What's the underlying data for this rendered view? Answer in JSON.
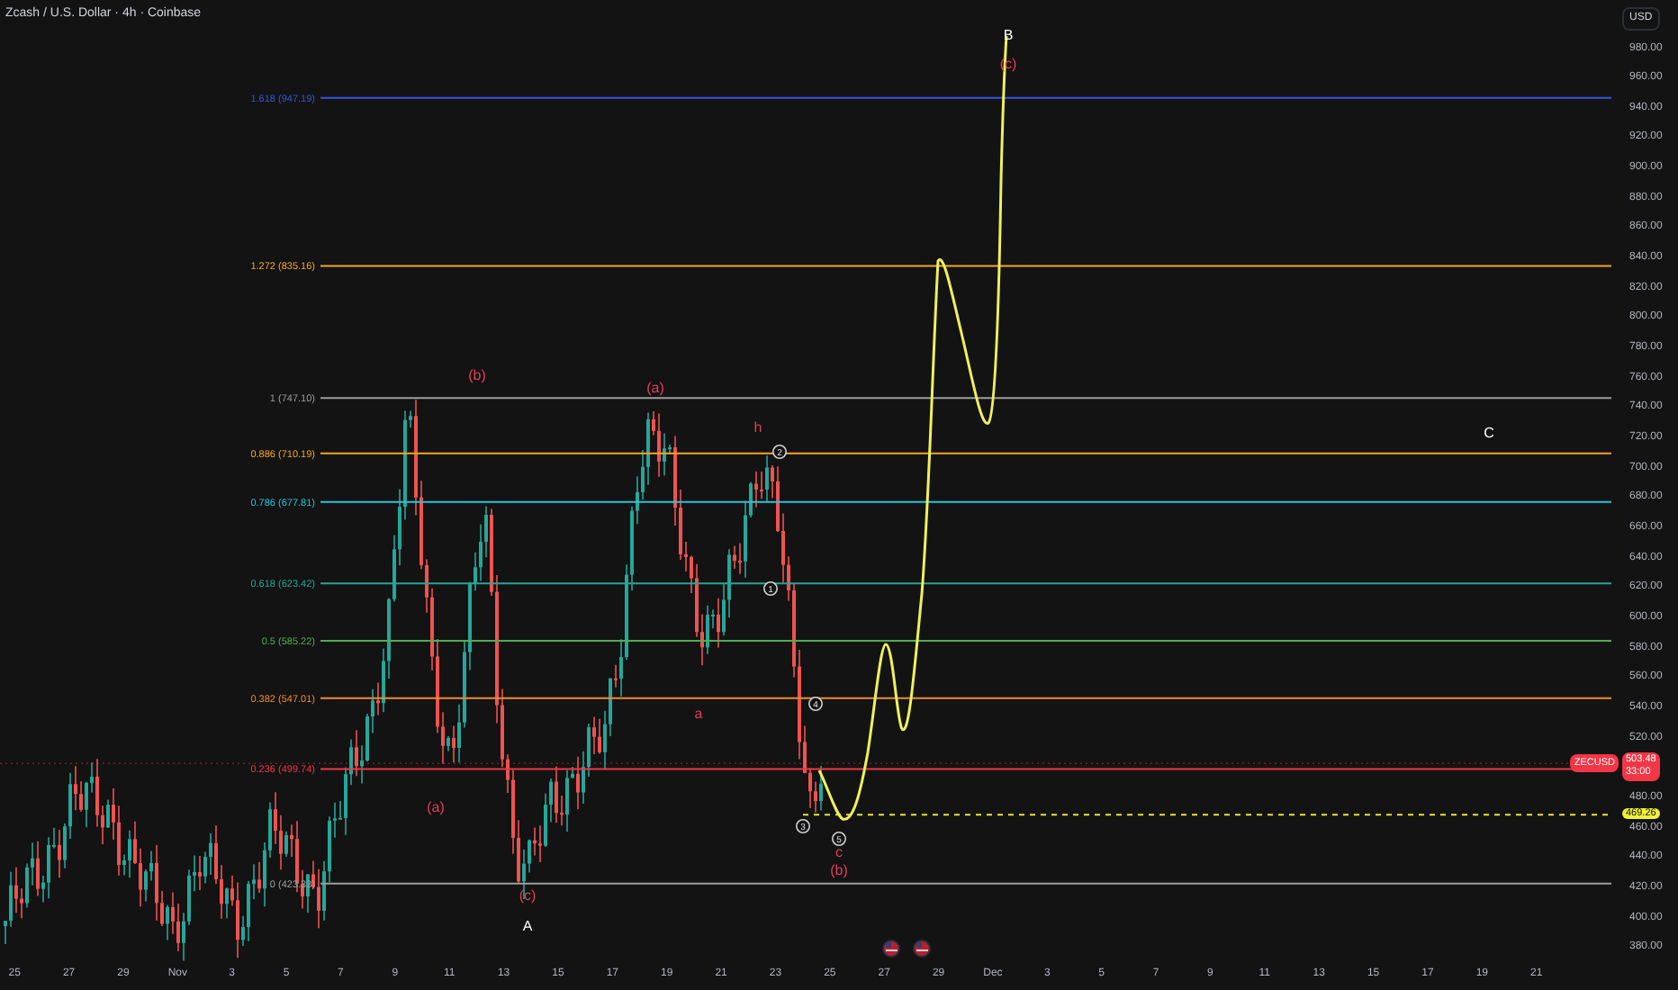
{
  "header": {
    "title": "Zcash / U.S. Dollar · 4h · Coinbase"
  },
  "currency": "USD",
  "price_axis": [
    "980.00",
    "960.00",
    "940.00",
    "920.00",
    "900.00",
    "880.00",
    "860.00",
    "840.00",
    "820.00",
    "800.00",
    "780.00",
    "760.00",
    "740.00",
    "720.00",
    "700.00",
    "680.00",
    "660.00",
    "640.00",
    "620.00",
    "600.00",
    "580.00",
    "560.00",
    "540.00",
    "520.00",
    "480.00",
    "460.00",
    "440.00",
    "420.00",
    "400.00",
    "380.00"
  ],
  "time_axis": [
    "25",
    "27",
    "29",
    "Nov",
    "3",
    "5",
    "7",
    "9",
    "11",
    "13",
    "15",
    "17",
    "19",
    "21",
    "23",
    "25",
    "27",
    "29",
    "Dec",
    "3",
    "5",
    "7",
    "9",
    "11",
    "13",
    "15",
    "17",
    "19",
    "21"
  ],
  "fib_levels": [
    {
      "label": "1.618 (947.19)",
      "color": "#3656e0"
    },
    {
      "label": "1.272 (835.16)",
      "color": "#f5a623"
    },
    {
      "label": "1 (747.10)",
      "color": "#9e9e9e"
    },
    {
      "label": "0.886 (710.19)",
      "color": "#f5a623"
    },
    {
      "label": "0.786 (677.81)",
      "color": "#26c6da"
    },
    {
      "label": "0.618 (623.42)",
      "color": "#26a69a"
    },
    {
      "label": "0.5 (585.22)",
      "color": "#4caf50"
    },
    {
      "label": "0.382 (547.01)",
      "color": "#f08c2e"
    },
    {
      "label": "0.236 (499.74)",
      "color": "#f23645"
    },
    {
      "label": "0 (423.33)",
      "color": "#9e9e9e"
    }
  ],
  "wave_labels": [
    {
      "text": "B",
      "color": "#ffffff"
    },
    {
      "text": "(c)",
      "color": "#e0405a"
    },
    {
      "text": "C",
      "color": "#ffffff"
    },
    {
      "text": "(a)",
      "color": "#e0405a"
    },
    {
      "text": "h",
      "color": "#e0405a"
    },
    {
      "text": "(b)",
      "color": "#e0405a"
    },
    {
      "text": "a",
      "color": "#e0405a"
    },
    {
      "text": "(a)",
      "color": "#e0405a"
    },
    {
      "text": "(c)",
      "color": "#e0405a"
    },
    {
      "text": "A",
      "color": "#ffffff"
    },
    {
      "text": "c",
      "color": "#e0405a"
    },
    {
      "text": "(b)",
      "color": "#e0405a"
    }
  ],
  "wave_counts": [
    {
      "text": "2"
    },
    {
      "text": "1"
    },
    {
      "text": "4"
    },
    {
      "text": "3"
    },
    {
      "text": "5"
    }
  ],
  "last_price": {
    "symbol": "ZECUSD",
    "price": "503.48",
    "countdown": "33:00"
  },
  "marker_price": "469.26"
}
